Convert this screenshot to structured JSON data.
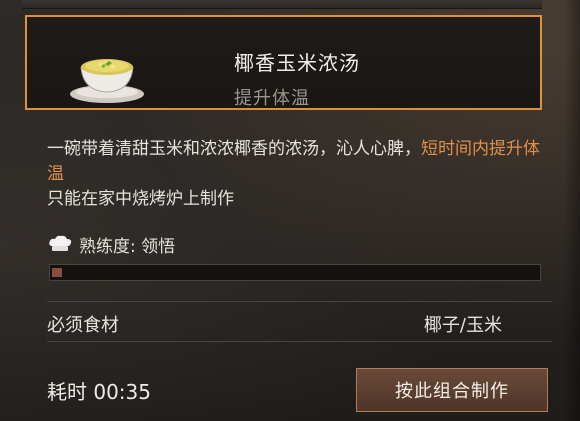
{
  "item": {
    "name": "椰香玉米浓汤",
    "effect": "提升体温"
  },
  "description": {
    "line1_start": "一碗带着清甜玉米和浓浓椰香的浓汤，沁人心脾，",
    "highlight": "短时间内提升体温",
    "line3": "只能在家中烧烤炉上制作"
  },
  "mastery": {
    "label": "熟练度: 领悟",
    "progress_fraction": 0.02
  },
  "ingredients": {
    "label": "必须食材",
    "value": "椰子/玉米"
  },
  "timer": "耗时 00:35",
  "craft_button": "按此组合制作",
  "colors": {
    "accent_border": "#e0903a",
    "highlight_text": "#e0904a",
    "progress_fill": "#8a4d3e",
    "button_bg": "#5c3f30"
  },
  "icons": {
    "dish": "soup-bowl-icon",
    "mastery": "chef-hat-icon"
  }
}
